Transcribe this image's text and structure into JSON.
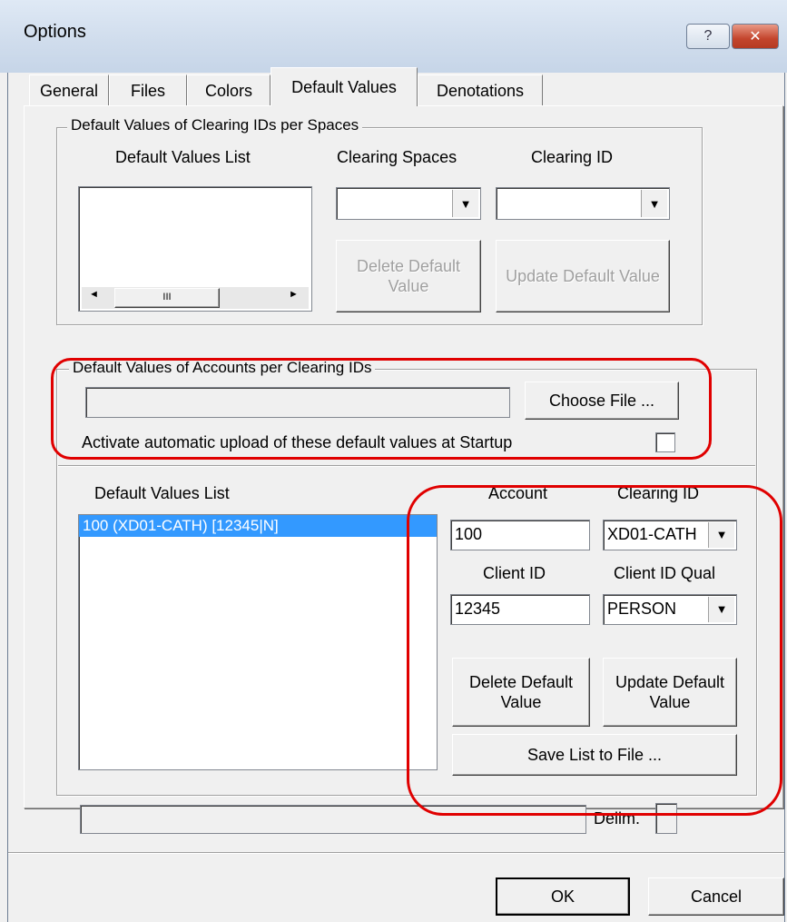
{
  "window": {
    "title": "Options",
    "help_glyph": "?",
    "close_glyph": "✕"
  },
  "tabs": [
    "General",
    "Files",
    "Colors",
    "Default Values",
    "Denotations"
  ],
  "group_spaces": {
    "title": "Default Values of Clearing IDs per Spaces",
    "list_label": "Default Values List",
    "spaces_label": "Clearing Spaces",
    "clearing_id_label": "Clearing ID",
    "delete_button": "Delete Default Value",
    "update_button": "Update Default Value",
    "scroll_left": "◄",
    "scroll_right": "►",
    "scroll_grip": "III",
    "dropdown_arrow": "▼"
  },
  "group_accounts": {
    "title": "Default Values of Accounts per Clearing IDs",
    "file_path": "",
    "choose_file_button": "Choose File ...",
    "auto_upload_label": "Activate automatic upload of these default values at Startup",
    "auto_upload_checked": false
  },
  "accounts_list": {
    "label": "Default Values List",
    "items": [
      "100 (XD01-CATH) [12345|N]"
    ],
    "account_label": "Account",
    "account_value": "100",
    "clearing_id_label": "Clearing ID",
    "clearing_id_value": "XD01-CATH",
    "client_id_label": "Client ID",
    "client_id_value": "12345",
    "client_id_qual_label": "Client ID Qual",
    "client_id_qual_value": "PERSON",
    "delete_button": "Delete Default Value",
    "update_button": "Update Default Value",
    "save_button": "Save List to File ...",
    "dropdown_arrow": "▼"
  },
  "delim_label": "Delim.",
  "footer": {
    "ok": "OK",
    "cancel": "Cancel"
  },
  "colors": {
    "highlight": "#e00000",
    "selection": "#3399ff"
  }
}
